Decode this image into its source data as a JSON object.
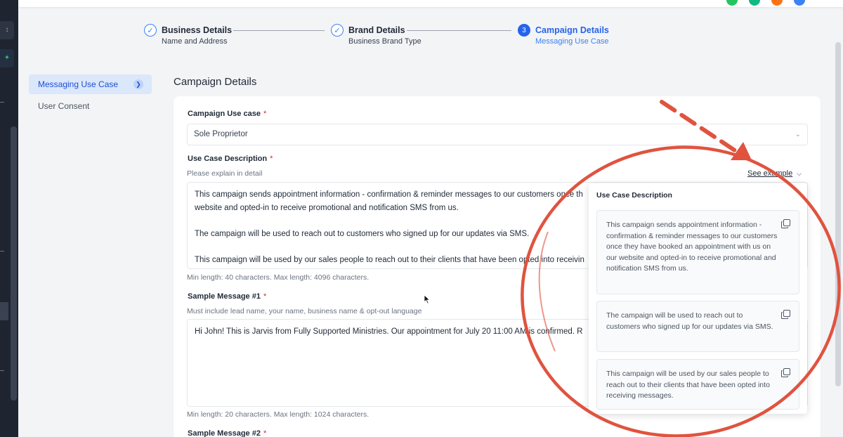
{
  "stepper": {
    "steps": [
      {
        "title": "Business Details",
        "subtitle": "Name and Address",
        "status": "done"
      },
      {
        "title": "Brand Details",
        "subtitle": "Business Brand Type",
        "status": "done"
      },
      {
        "title": "Campaign Details",
        "subtitle": "Messaging Use Case",
        "status": "active",
        "number": "3"
      }
    ]
  },
  "sidebar": {
    "items": [
      {
        "label": "Messaging Use Case",
        "active": true
      },
      {
        "label": "User Consent",
        "active": false
      }
    ]
  },
  "page_title": "Campaign Details",
  "form": {
    "use_case": {
      "label": "Campaign Use case",
      "required": "*",
      "value": "Sole Proprietor"
    },
    "description": {
      "label": "Use Case Description",
      "required": "*",
      "help": "Please explain in detail",
      "see_example": "See example",
      "lines": [
        "This campaign sends appointment information - confirmation & reminder messages to our customers once th",
        "website and opted-in to receive promotional and notification SMS from us.",
        "",
        "The campaign will be used to reach out to customers who signed up for our updates via SMS.",
        "",
        "This campaign will be used by our sales people to reach out to their clients that have been opted into receivin"
      ],
      "limits": "Min length: 40 characters. Max length: 4096 characters."
    },
    "sample1": {
      "label": "Sample Message #1",
      "required": "*",
      "help": "Must include lead name, your name, business name & opt-out language",
      "value": "Hi John! This is Jarvis from Fully Supported Ministries. Our appointment for July 20 11:00 AM is confirmed. R",
      "limits": "Min length: 20 characters. Max length: 1024 characters."
    },
    "sample2": {
      "label": "Sample Message #2",
      "required": "*"
    }
  },
  "example_popover": {
    "title": "Use Case Description",
    "examples": [
      "This campaign sends appointment information - confirmation & reminder messages to our customers once they have booked an appointment with us on our website and opted-in to receive promotional and notification SMS from us.",
      "The campaign will be used to reach out to customers who signed up for our updates via SMS.",
      "This campaign will be used by our sales people to reach out to their clients that have been opted into receiving messages."
    ]
  },
  "colors": {
    "accent": "#2563eb",
    "annotation": "#e0533f",
    "required": "#dc2626"
  }
}
